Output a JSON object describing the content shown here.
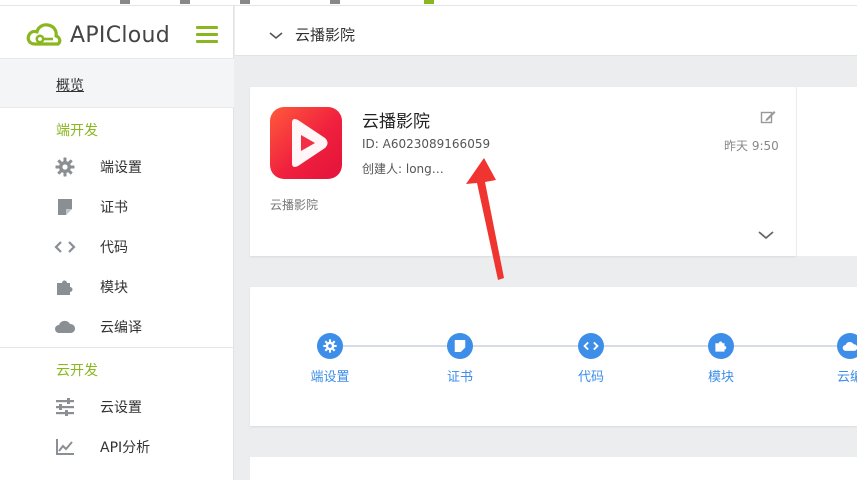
{
  "app": {
    "logo_text": "APICloud"
  },
  "sidebar": {
    "overview": "概览",
    "sections": [
      {
        "title": "端开发",
        "items": [
          {
            "label": "端设置",
            "icon": "gear-icon"
          },
          {
            "label": "证书",
            "icon": "certificate-icon"
          },
          {
            "label": "代码",
            "icon": "code-icon"
          },
          {
            "label": "模块",
            "icon": "puzzle-icon"
          },
          {
            "label": "云编译",
            "icon": "cloud-icon"
          }
        ]
      },
      {
        "title": "云开发",
        "items": [
          {
            "label": "云设置",
            "icon": "sliders-icon"
          },
          {
            "label": "API分析",
            "icon": "chart-icon"
          }
        ]
      }
    ]
  },
  "header": {
    "title": "云播影院"
  },
  "app_card": {
    "name": "云播影院",
    "id_text": "ID: A6023089166059",
    "creator_text": "创建人: long…",
    "subtitle": "云播影院",
    "time": "昨天 9:50"
  },
  "steps": [
    {
      "label": "端设置",
      "icon": "gear-icon"
    },
    {
      "label": "证书",
      "icon": "certificate-icon"
    },
    {
      "label": "代码",
      "icon": "code-icon"
    },
    {
      "label": "模块",
      "icon": "puzzle-icon"
    },
    {
      "label": "云编",
      "icon": "cloud-icon"
    }
  ],
  "colors": {
    "brand_green": "#8ab71f",
    "step_blue": "#3d8ee8",
    "annotation_red": "#f0342f"
  }
}
